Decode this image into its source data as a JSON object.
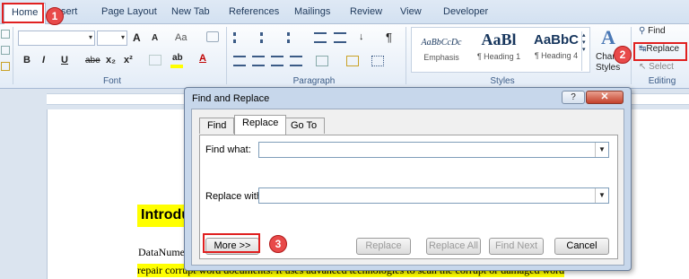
{
  "ribbon_tabs": [
    "Home",
    "Insert",
    "Page Layout",
    "New Tab",
    "References",
    "Mailings",
    "Review",
    "View",
    "Developer"
  ],
  "ribbon_tab_visible": {
    "insert": "sert"
  },
  "font_group": {
    "label": "Font",
    "grow": "A",
    "shrink": "A",
    "case": "Aa",
    "bold": "B",
    "italic": "I",
    "underline": "U",
    "strike": "abe",
    "sub": "x₂",
    "sup": "x²",
    "font_color": "A"
  },
  "paragraph_group": {
    "label": "Paragraph",
    "pilcrow": "¶"
  },
  "styles_group": {
    "label": "Styles",
    "items": [
      {
        "sample": "AaBbCcDc",
        "name": "Emphasis"
      },
      {
        "sample": "AaBl",
        "name": "¶ Heading 1"
      },
      {
        "sample": "AaBbC",
        "name": "¶ Heading 4"
      }
    ],
    "change_styles": [
      "Change",
      "Styles"
    ]
  },
  "editing_group": {
    "label": "Editing",
    "find": "Find",
    "replace": "Replace",
    "select": "Select"
  },
  "document": {
    "heading": "Introdu",
    "line1": "DataNume",
    "line2": "repair corrupt word documents. It uses advanced technologies to scan the corrupt or damaged word"
  },
  "dialog": {
    "title": "Find and Replace",
    "help": "?",
    "close": "✕",
    "tabs": [
      "Find",
      "Replace",
      "Go To"
    ],
    "active_tab": "Replace",
    "find_label": "Find what:",
    "replace_label": "Replace with:",
    "find_value": "",
    "replace_value": "",
    "buttons": {
      "more": "More >>",
      "replace": "Replace",
      "replace_all": "Replace All",
      "find_next": "Find Next",
      "cancel": "Cancel"
    }
  },
  "annotations": [
    "1",
    "2",
    "3"
  ],
  "colors": {
    "annotation": "#e02020",
    "highlight": "#ffff00"
  }
}
